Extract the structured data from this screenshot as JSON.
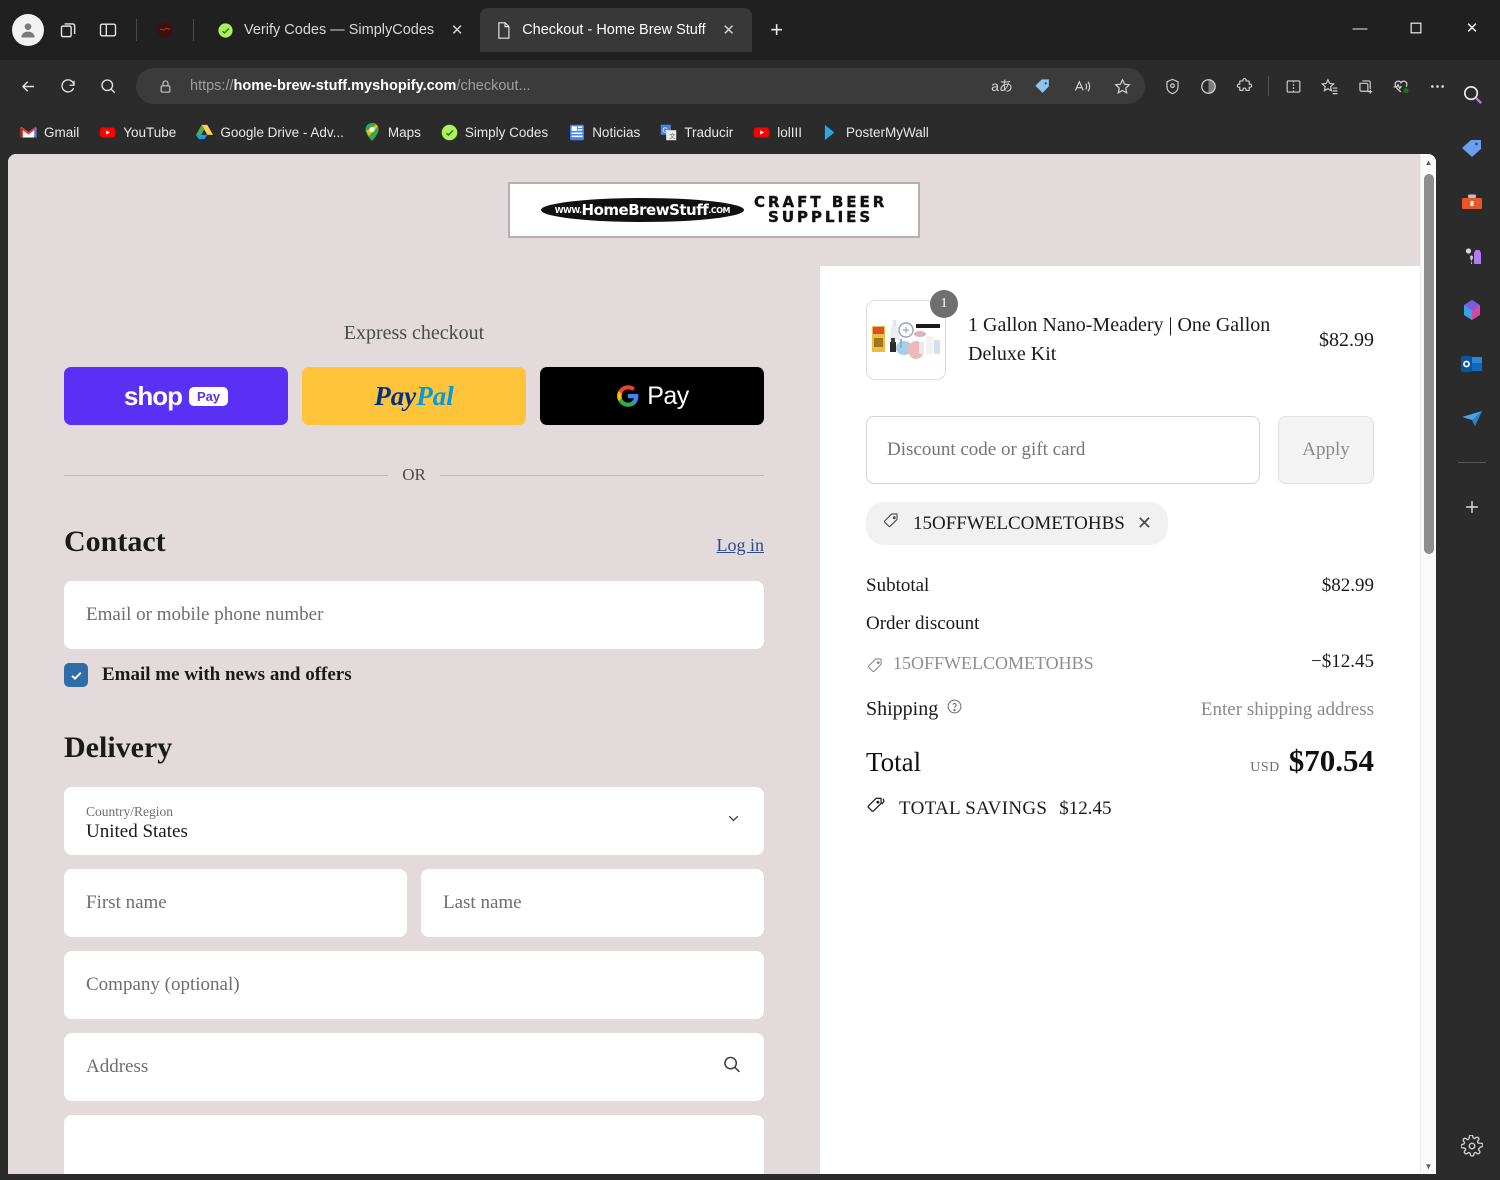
{
  "browser": {
    "tabs": [
      {
        "title": "Verify Codes — SimplyCodes",
        "favicon": "simplycodes-icon",
        "active": false
      },
      {
        "title": "Checkout - Home Brew Stuff",
        "favicon": "page-icon",
        "active": true
      }
    ],
    "omnibox": {
      "scheme": "https://",
      "domain": "home-brew-stuff.myshopify.com",
      "path": "/checkout...",
      "lock_icon": "lock-icon",
      "translate_icon": "translate-icon",
      "coupon_icon": "coupon-tag-icon",
      "read_aloud_icon": "read-aloud-icon",
      "favorite_icon": "star-icon"
    },
    "bookmarks": [
      {
        "label": "Gmail",
        "icon": "gmail-icon"
      },
      {
        "label": "YouTube",
        "icon": "youtube-icon"
      },
      {
        "label": "Google Drive - Adv...",
        "icon": "google-drive-icon"
      },
      {
        "label": "Maps",
        "icon": "google-maps-icon"
      },
      {
        "label": "Simply Codes",
        "icon": "simplycodes-icon"
      },
      {
        "label": "Noticias",
        "icon": "news-icon"
      },
      {
        "label": "Traducir",
        "icon": "google-translate-icon"
      },
      {
        "label": "lolIII",
        "icon": "youtube-icon"
      },
      {
        "label": "PosterMyWall",
        "icon": "postermywall-icon"
      }
    ],
    "bookmarks_overflow": "›",
    "window_controls": {
      "minimize": "—",
      "maximize": "▢",
      "close": "✕"
    },
    "new_tab_label": "+",
    "sidebar_icons": [
      "search-icon",
      "shopping-tag-icon",
      "tools-icon",
      "games-icon",
      "microsoft-365-icon",
      "outlook-icon",
      "telegram-plane-icon"
    ],
    "sidebar_add_label": "+"
  },
  "site": {
    "logo": {
      "brand": "HomeBrewStuff",
      "www": "WWW.",
      "dotcom": ".COM",
      "tagline_line1": "CRAFT BEER",
      "tagline_line2": "SUPPLIES"
    }
  },
  "express": {
    "title": "Express checkout",
    "buttons": [
      {
        "name": "shop-pay",
        "word": "shop",
        "chip": "Pay"
      },
      {
        "name": "paypal",
        "part1": "Pay",
        "part2": "Pal"
      },
      {
        "name": "google-pay",
        "text": "Pay"
      }
    ],
    "divider_text": "OR"
  },
  "contact": {
    "title": "Contact",
    "login_label": "Log in",
    "email_placeholder": "Email or mobile phone number",
    "newsletter_label": "Email me with news and offers",
    "newsletter_checked": true
  },
  "delivery": {
    "title": "Delivery",
    "country_label": "Country/Region",
    "country_value": "United States",
    "first_name_placeholder": "First name",
    "last_name_placeholder": "Last name",
    "company_placeholder": "Company (optional)",
    "address_placeholder": "Address"
  },
  "summary": {
    "item": {
      "name": "1 Gallon Nano-Meadery | One Gallon Deluxe Kit",
      "price": "$82.99",
      "quantity": "1"
    },
    "discount_placeholder": "Discount code or gift card",
    "apply_label": "Apply",
    "applied_chip": {
      "code": "15OFFWELCOMETOHBS",
      "remove": "✕"
    },
    "subtotal_label": "Subtotal",
    "subtotal_value": "$82.99",
    "order_discount_label": "Order discount",
    "discount_code": "15OFFWELCOMETOHBS",
    "discount_amount": "−$12.45",
    "shipping_label": "Shipping",
    "shipping_value": "Enter shipping address",
    "total_label": "Total",
    "total_currency": "USD",
    "total_value": "$70.54",
    "savings_label": "TOTAL SAVINGS",
    "savings_value": "$12.45"
  },
  "colors": {
    "page_bg": "#e3dbdb",
    "panel_bg": "#ffffff",
    "accent_shop_pay": "#5a31f4",
    "accent_paypal": "#ffc439",
    "accent_checkbox": "#2f6ca8",
    "link": "#2b4a8b"
  }
}
